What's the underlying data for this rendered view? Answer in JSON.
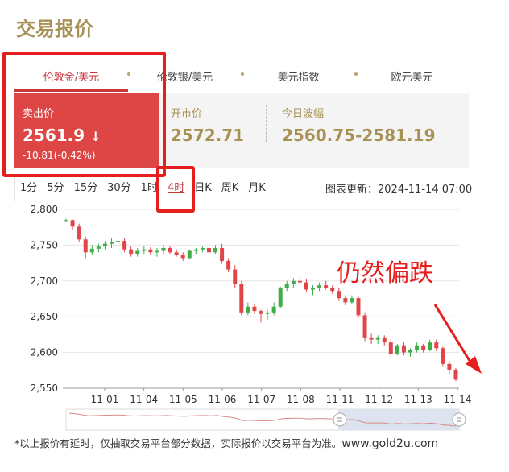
{
  "header": {
    "title": "交易报价"
  },
  "tabs": [
    {
      "label": "伦敦金/美元",
      "active": true
    },
    {
      "label": "伦敦银/美元",
      "active": false
    },
    {
      "label": "美元指数",
      "active": false
    },
    {
      "label": "欧元美元",
      "active": false
    }
  ],
  "quote": {
    "sell_label": "卖出价",
    "sell_value": "2561.9",
    "sell_arrow": "↓",
    "change": "-10.81(-0.42%)",
    "open_label": "开市价",
    "open_value": "2572.71",
    "range_label": "今日波幅",
    "range_value": "2560.75-2581.19"
  },
  "periods": [
    {
      "label": "1分",
      "active": false
    },
    {
      "label": "5分",
      "active": false
    },
    {
      "label": "15分",
      "active": false
    },
    {
      "label": "30分",
      "active": false
    },
    {
      "label": "1时",
      "active": false
    },
    {
      "label": "4时",
      "active": true
    },
    {
      "label": "日K",
      "active": false
    },
    {
      "label": "周K",
      "active": false
    },
    {
      "label": "月K",
      "active": false
    }
  ],
  "updated": {
    "label": "图表更新：",
    "time": "2024-11-14 07:00"
  },
  "annotation": "仍然偏跌",
  "disclaimer": {
    "text": "*以上报价有延时，仅抽取交易平台部分数据，实际报价以交易平台为准。",
    "site": "www.gold2u.com"
  },
  "colors": {
    "up": "#3fae49",
    "down": "#e0454a",
    "accent": "#c8363a",
    "gold": "#a89155",
    "highlight": "#e51e1e"
  },
  "chart_data": {
    "type": "candlestick",
    "ylim": [
      2550,
      2800
    ],
    "y_ticks": [
      "2,800",
      "2,750",
      "2,700",
      "2,650",
      "2,600",
      "2,550"
    ],
    "x_ticks": [
      "11-01",
      "11-04",
      "11-05",
      "11-06",
      "11-07",
      "11-08",
      "11-11",
      "11-12",
      "11-13",
      "11-14"
    ],
    "candles": [
      [
        2784,
        2787,
        2782,
        2785
      ],
      [
        2785,
        2786,
        2772,
        2776
      ],
      [
        2776,
        2780,
        2755,
        2758
      ],
      [
        2758,
        2762,
        2732,
        2740
      ],
      [
        2740,
        2750,
        2736,
        2745
      ],
      [
        2745,
        2752,
        2740,
        2748
      ],
      [
        2748,
        2756,
        2744,
        2752
      ],
      [
        2752,
        2760,
        2746,
        2754
      ],
      [
        2754,
        2762,
        2748,
        2756
      ],
      [
        2756,
        2760,
        2740,
        2744
      ],
      [
        2744,
        2748,
        2734,
        2738
      ],
      [
        2738,
        2746,
        2734,
        2742
      ],
      [
        2742,
        2748,
        2738,
        2744
      ],
      [
        2744,
        2747,
        2736,
        2740
      ],
      [
        2740,
        2746,
        2734,
        2742
      ],
      [
        2742,
        2750,
        2738,
        2746
      ],
      [
        2746,
        2748,
        2738,
        2740
      ],
      [
        2740,
        2744,
        2734,
        2736
      ],
      [
        2736,
        2740,
        2728,
        2732
      ],
      [
        2732,
        2744,
        2730,
        2742
      ],
      [
        2742,
        2746,
        2738,
        2744
      ],
      [
        2744,
        2748,
        2740,
        2746
      ],
      [
        2746,
        2748,
        2738,
        2740
      ],
      [
        2740,
        2750,
        2738,
        2746
      ],
      [
        2746,
        2752,
        2724,
        2728
      ],
      [
        2728,
        2732,
        2712,
        2716
      ],
      [
        2716,
        2722,
        2690,
        2696
      ],
      [
        2696,
        2700,
        2652,
        2656
      ],
      [
        2656,
        2670,
        2652,
        2664
      ],
      [
        2664,
        2668,
        2654,
        2658
      ],
      [
        2658,
        2660,
        2642,
        2654
      ],
      [
        2654,
        2660,
        2646,
        2656
      ],
      [
        2656,
        2670,
        2652,
        2664
      ],
      [
        2664,
        2692,
        2662,
        2690
      ],
      [
        2690,
        2700,
        2686,
        2696
      ],
      [
        2696,
        2704,
        2690,
        2700
      ],
      [
        2700,
        2706,
        2694,
        2698
      ],
      [
        2698,
        2702,
        2684,
        2688
      ],
      [
        2688,
        2694,
        2680,
        2690
      ],
      [
        2690,
        2698,
        2686,
        2694
      ],
      [
        2694,
        2700,
        2688,
        2690
      ],
      [
        2690,
        2694,
        2682,
        2686
      ],
      [
        2686,
        2690,
        2672,
        2676
      ],
      [
        2676,
        2680,
        2666,
        2670
      ],
      [
        2670,
        2680,
        2668,
        2676
      ],
      [
        2676,
        2678,
        2648,
        2652
      ],
      [
        2652,
        2656,
        2616,
        2620
      ],
      [
        2620,
        2626,
        2612,
        2618
      ],
      [
        2618,
        2624,
        2612,
        2620
      ],
      [
        2620,
        2624,
        2610,
        2614
      ],
      [
        2614,
        2618,
        2594,
        2598
      ],
      [
        2598,
        2612,
        2596,
        2610
      ],
      [
        2610,
        2614,
        2596,
        2600
      ],
      [
        2600,
        2606,
        2594,
        2604
      ],
      [
        2604,
        2614,
        2600,
        2610
      ],
      [
        2610,
        2612,
        2600,
        2604
      ],
      [
        2604,
        2618,
        2602,
        2614
      ],
      [
        2614,
        2618,
        2602,
        2606
      ],
      [
        2606,
        2608,
        2580,
        2584
      ],
      [
        2584,
        2588,
        2570,
        2576
      ],
      [
        2576,
        2578,
        2560,
        2562
      ]
    ]
  }
}
